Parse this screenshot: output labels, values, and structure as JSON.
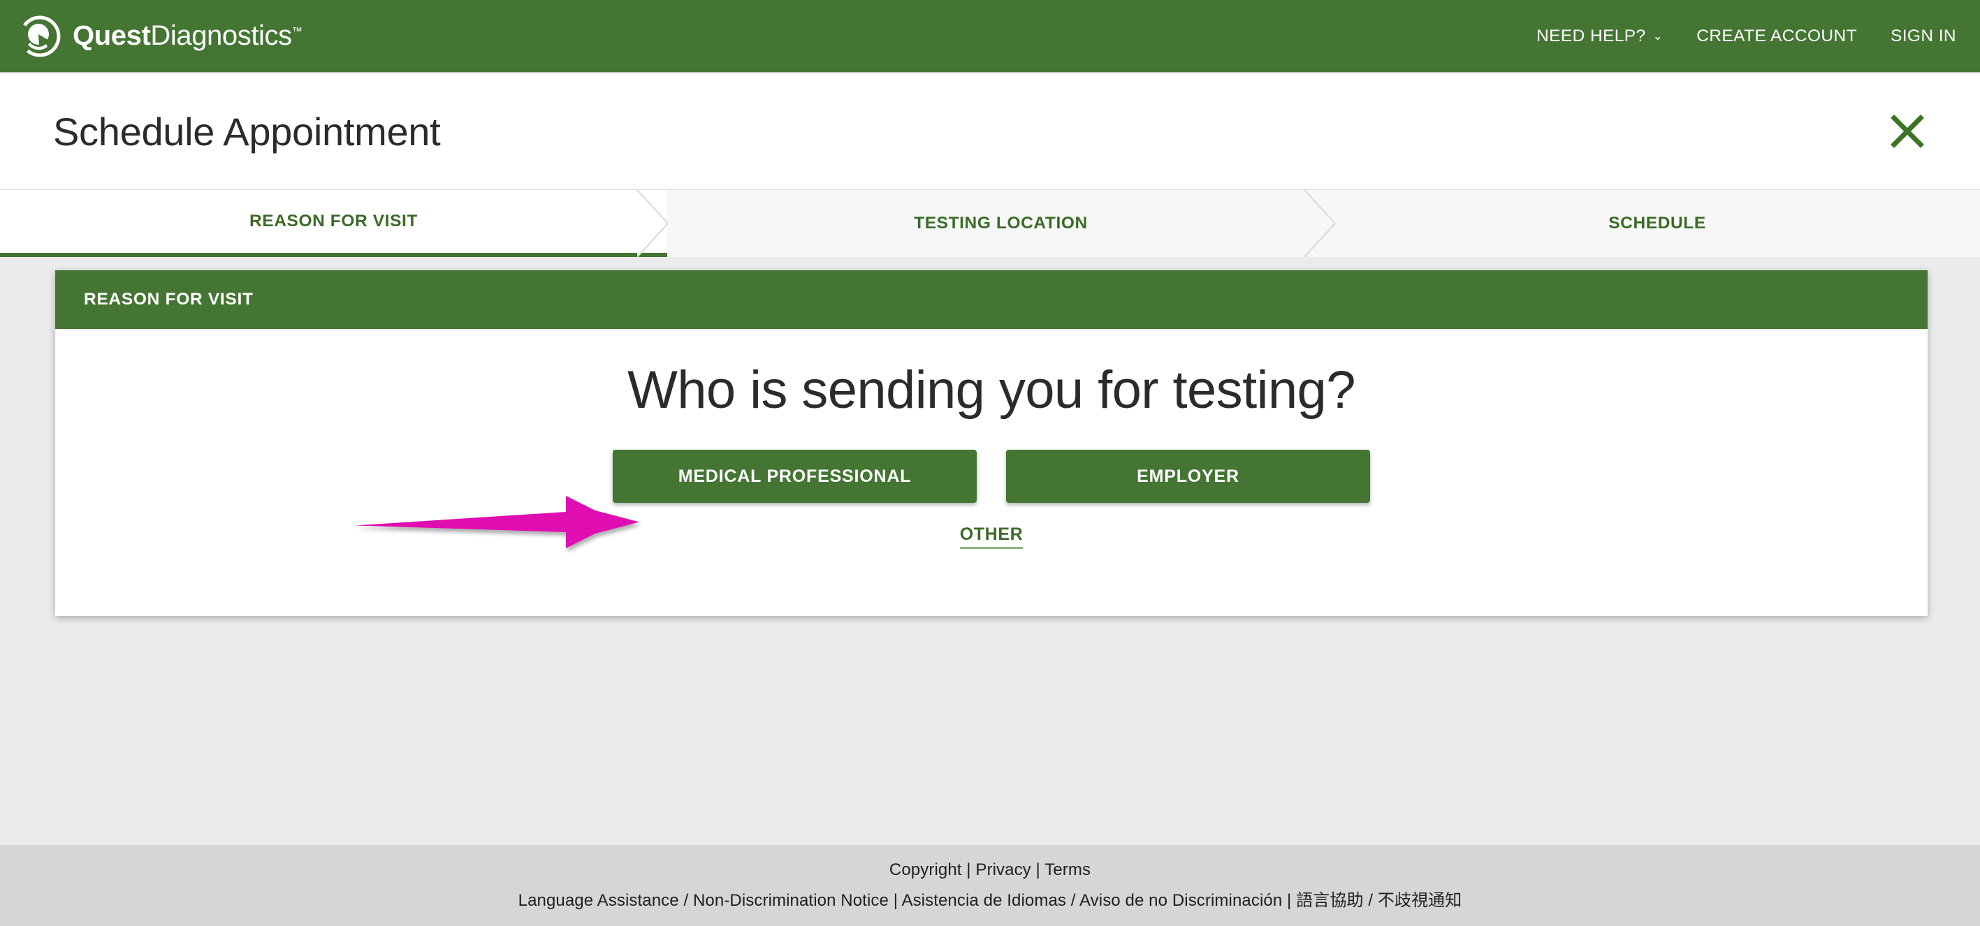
{
  "brand": {
    "logo_icon": "quest-diagnostics-logo-icon",
    "name_bold": "Quest",
    "name_light": "Diagnostics",
    "trademark": "™"
  },
  "header": {
    "background_color": "#447533",
    "nav": [
      {
        "label": "NEED HELP?",
        "has_caret": true,
        "caret_icon": "chevron-down-icon"
      },
      {
        "label": "CREATE ACCOUNT",
        "has_caret": false
      },
      {
        "label": "SIGN IN",
        "has_caret": false
      }
    ]
  },
  "titlebar": {
    "title": "Schedule Appointment",
    "close_icon": "close-x-icon",
    "close_color": "#3b7523"
  },
  "tabs": {
    "active_index": 0,
    "items": [
      {
        "label": "REASON FOR VISIT",
        "active": true
      },
      {
        "label": "TESTING LOCATION",
        "active": false
      },
      {
        "label": "SCHEDULE",
        "active": false
      }
    ]
  },
  "card": {
    "header_label": "REASON FOR VISIT",
    "question": "Who is sending you for testing?",
    "choices": [
      {
        "label": "MEDICAL PROFESSIONAL"
      },
      {
        "label": "EMPLOYER"
      }
    ],
    "other_link": "OTHER"
  },
  "annotation": {
    "arrow_icon": "magenta-pointer-arrow-icon",
    "color": "#E010B0",
    "points_to": "MEDICAL PROFESSIONAL"
  },
  "footer": {
    "line1": "Copyright | Privacy | Terms",
    "line2": "Language Assistance / Non-Discrimination Notice | Asistencia de Idiomas / Aviso de no Discriminación | 語言協助 / 不歧視通知"
  },
  "colors": {
    "brand_green": "#447533",
    "link_green": "#3b6b28",
    "page_background": "#ebebeb",
    "footer_background": "#d6d6d6",
    "accent_magenta": "#E010B0"
  }
}
